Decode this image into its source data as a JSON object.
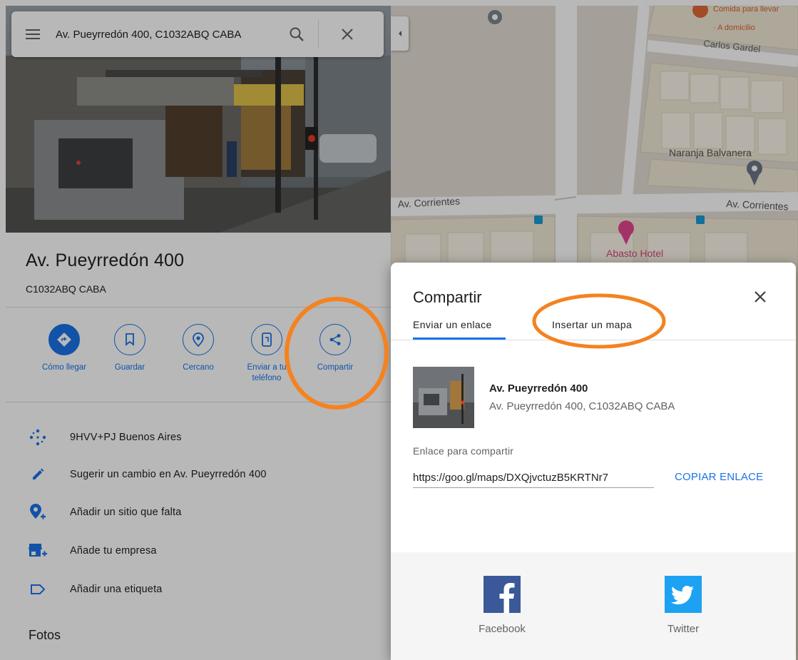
{
  "search": {
    "value": "Av. Pueyrredón 400, C1032ABQ CABA"
  },
  "place": {
    "title": "Av. Pueyrredón 400",
    "subtitle": "C1032ABQ CABA"
  },
  "actions": [
    {
      "label": "Cómo llegar"
    },
    {
      "label": "Guardar"
    },
    {
      "label": "Cercano"
    },
    {
      "label": "Enviar a tu teléfono"
    },
    {
      "label": "Compartir"
    }
  ],
  "info_rows": [
    {
      "text": "9HVV+PJ Buenos Aires",
      "icon": "plus-code-icon"
    },
    {
      "text": "Sugerir un cambio en Av. Pueyrredón 400",
      "icon": "pencil-icon"
    },
    {
      "text": "Añadir un sitio que falta",
      "icon": "add-place-icon"
    },
    {
      "text": "Añade tu empresa",
      "icon": "add-business-icon"
    },
    {
      "text": "Añadir una etiqueta",
      "icon": "label-icon"
    }
  ],
  "photos_heading": "Fotos",
  "map": {
    "labels": {
      "comida": "Comida para llevar",
      "adomicilio": "· A domicilio",
      "carlos": "Carlos Gardel",
      "naranja": "Naranja Balvanera",
      "corrientes_left": "Av. Corrientes",
      "corrientes_right": "Av. Corrientes",
      "abasto": "Abasto Hotel"
    }
  },
  "dialog": {
    "title": "Compartir",
    "tabs": {
      "link": "Enviar un enlace",
      "embed": "Insertar un mapa"
    },
    "preview": {
      "name": "Av. Pueyrredón 400",
      "address": "Av. Pueyrredón 400, C1032ABQ CABA"
    },
    "share_label": "Enlace para compartir",
    "share_url": "https://goo.gl/maps/DXQjvctuzB5KRTNr7",
    "copy_label": "COPIAR ENLACE",
    "social": [
      {
        "name": "Facebook"
      },
      {
        "name": "Twitter"
      }
    ]
  },
  "colors": {
    "accent": "#1a73e8",
    "annotation": "#f5821f",
    "facebook": "#3b5998",
    "twitter": "#1da1f2"
  }
}
